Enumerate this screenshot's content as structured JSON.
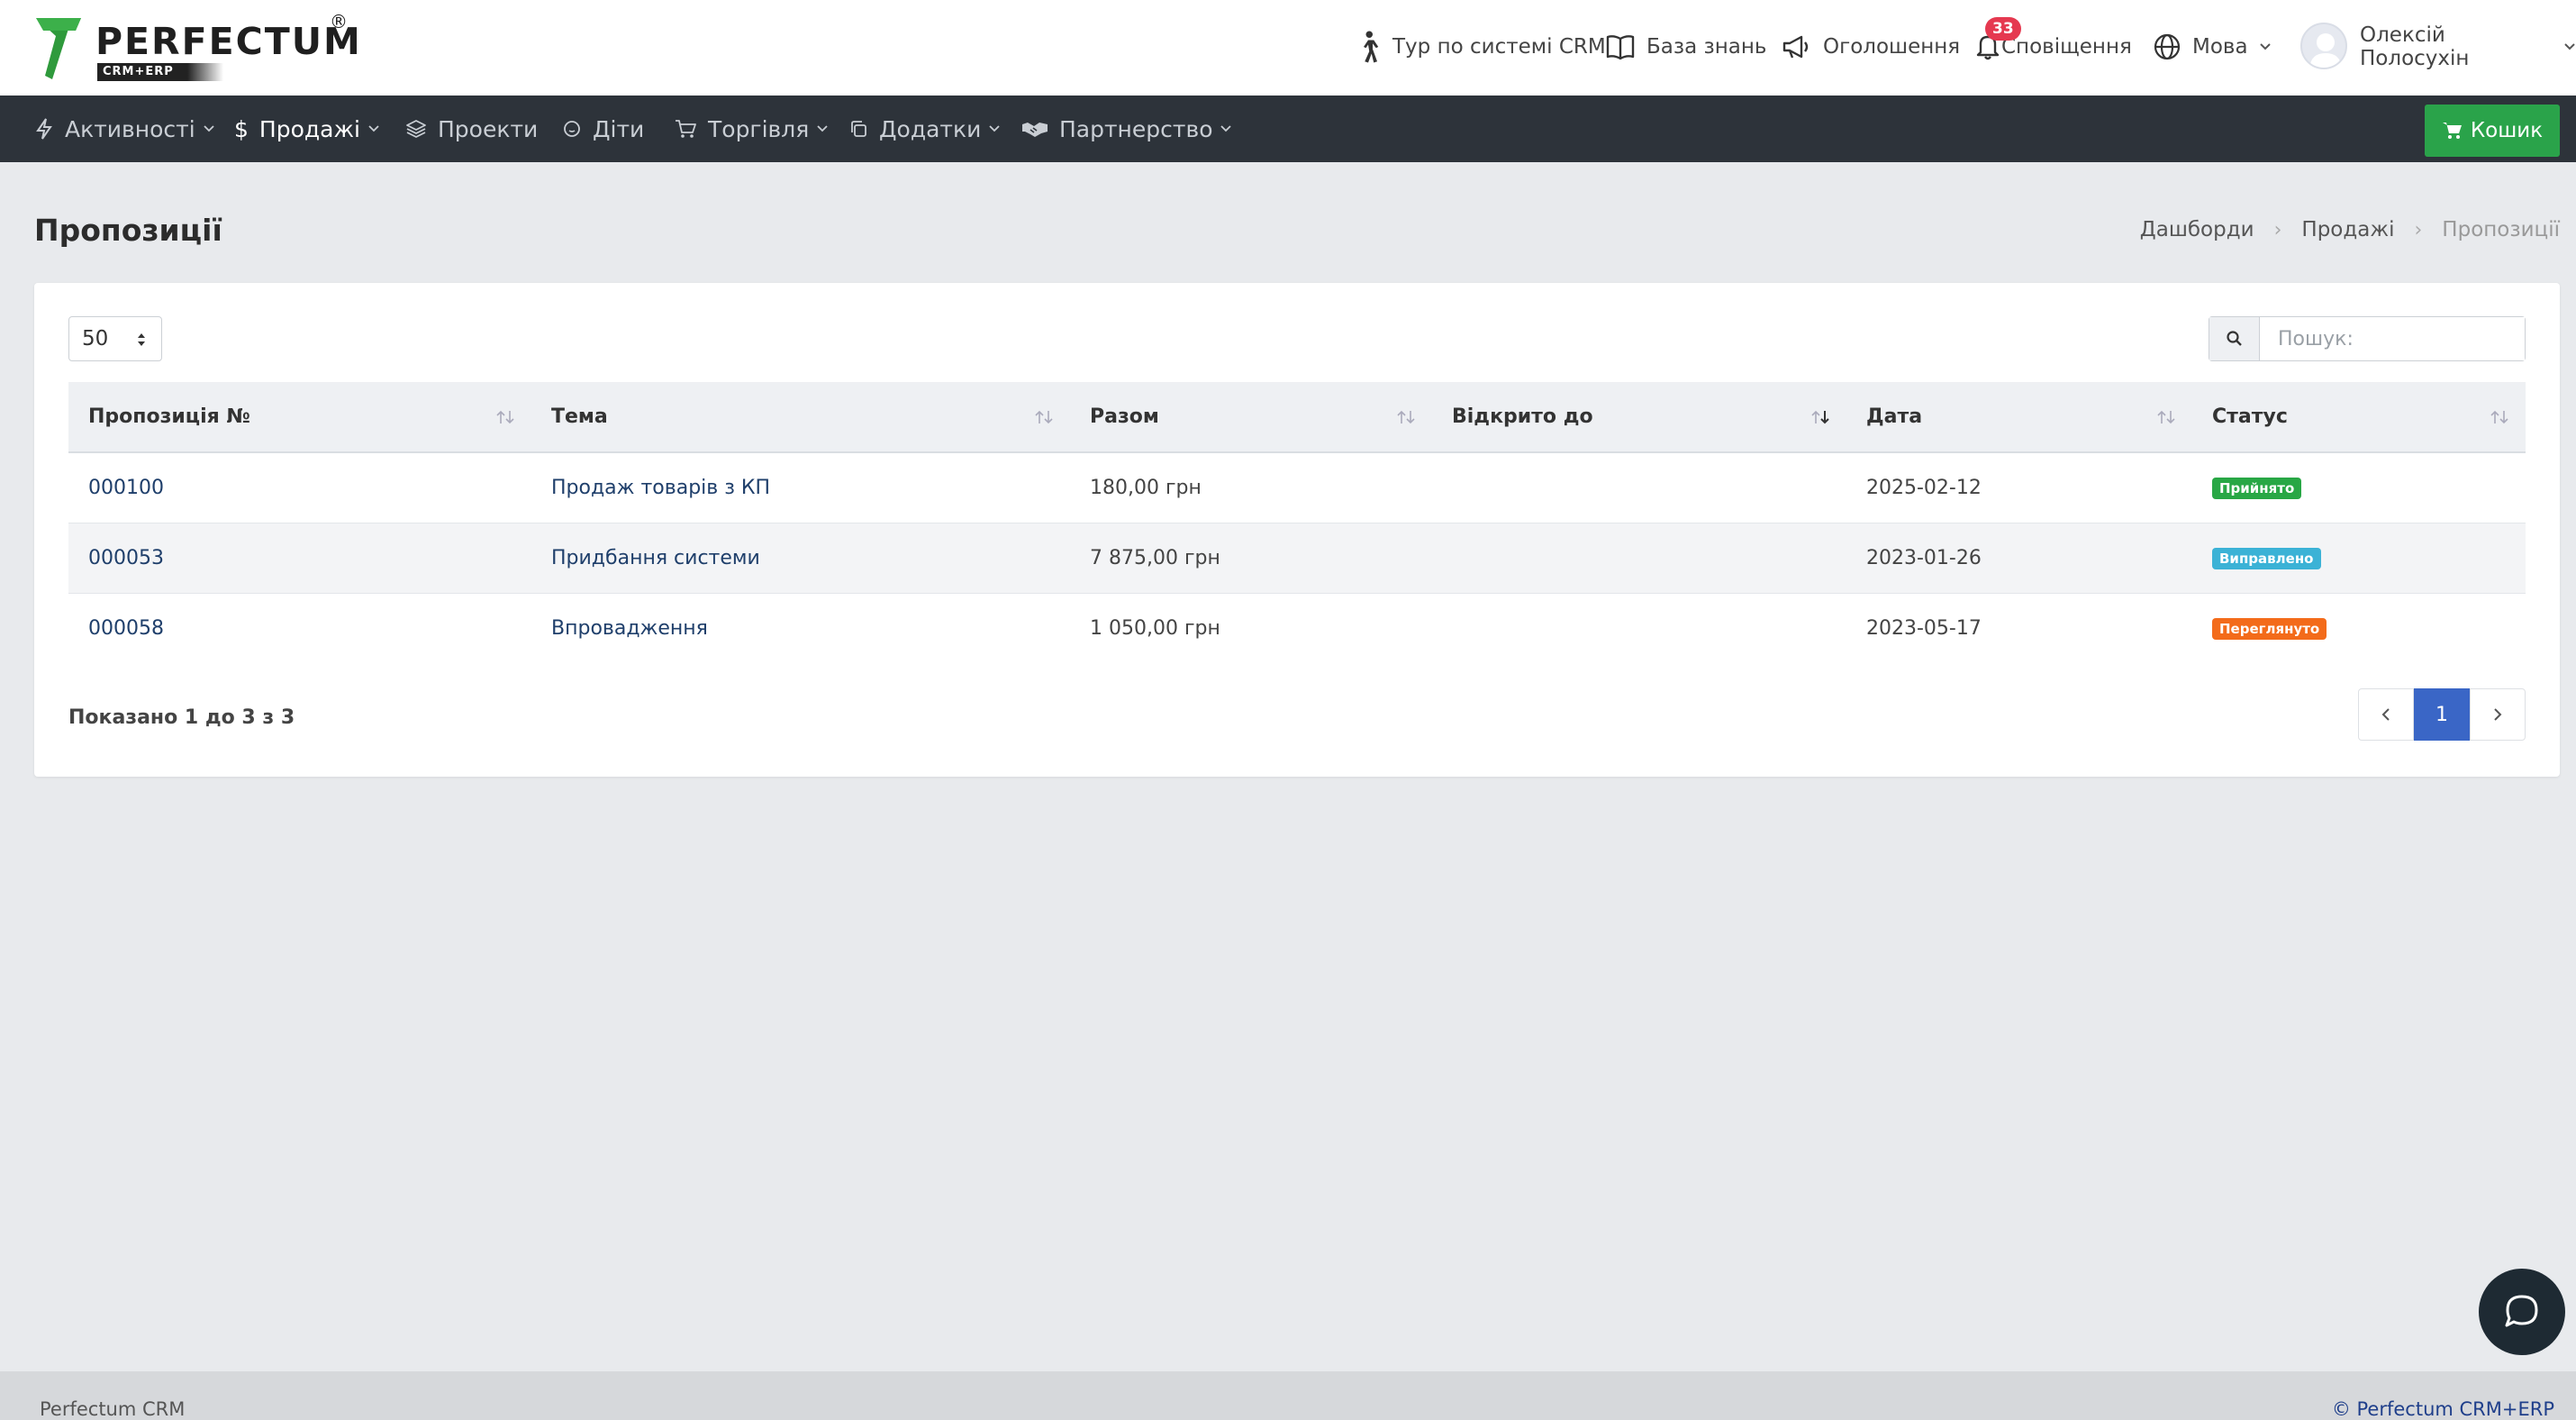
{
  "brand": {
    "name": "PERFECTUM",
    "sub": "CRM+ERP",
    "reg": "®"
  },
  "topnav": {
    "tour": "Тур по системі CRM",
    "kb": "База знань",
    "announcements": "Оголошення",
    "notifications": "Сповіщення",
    "notifications_count": "33",
    "language": "Мова",
    "user": "Олексій Полосухін"
  },
  "mainnav": {
    "activities": "Активності",
    "sales": "Продажі",
    "projects": "Проекти",
    "kids": "Діти",
    "trade": "Торгівля",
    "addons": "Додатки",
    "partnership": "Партнерство",
    "cart": "Кошик"
  },
  "page": {
    "title": "Пропозиції"
  },
  "breadcrumb": {
    "b1": "Дашборди",
    "b2": "Продажі",
    "b3": "Пропозиції"
  },
  "table": {
    "length": "50",
    "search_placeholder": "Пошук:",
    "headers": [
      "Пропозиція №",
      "Тема",
      "Разом",
      "Відкрито до",
      "Дата",
      "Статус"
    ],
    "rows": [
      {
        "num": "000100",
        "subject": "Продаж товарів з КП",
        "total": "180,00 грн",
        "open_till": "",
        "date": "2025-02-12",
        "status": "Прийнято"
      },
      {
        "num": "000053",
        "subject": "Придбання системи",
        "total": "7 875,00 грн",
        "open_till": "",
        "date": "2023-01-26",
        "status": "Виправлено"
      },
      {
        "num": "000058",
        "subject": "Впровадження",
        "total": "1 050,00 грн",
        "open_till": "",
        "date": "2023-05-17",
        "status": "Переглянуто"
      }
    ],
    "info": "Показано 1 до 3 з 3",
    "page": "1"
  },
  "colors": {
    "accepted": "#28a745",
    "revised": "#3bb2d6",
    "viewed": "#f36b1a",
    "cart": "#2aa34a",
    "page_active": "#3a66c6"
  },
  "footer": {
    "left": "Perfectum CRM",
    "right": "© Perfectum CRM+ERP"
  }
}
